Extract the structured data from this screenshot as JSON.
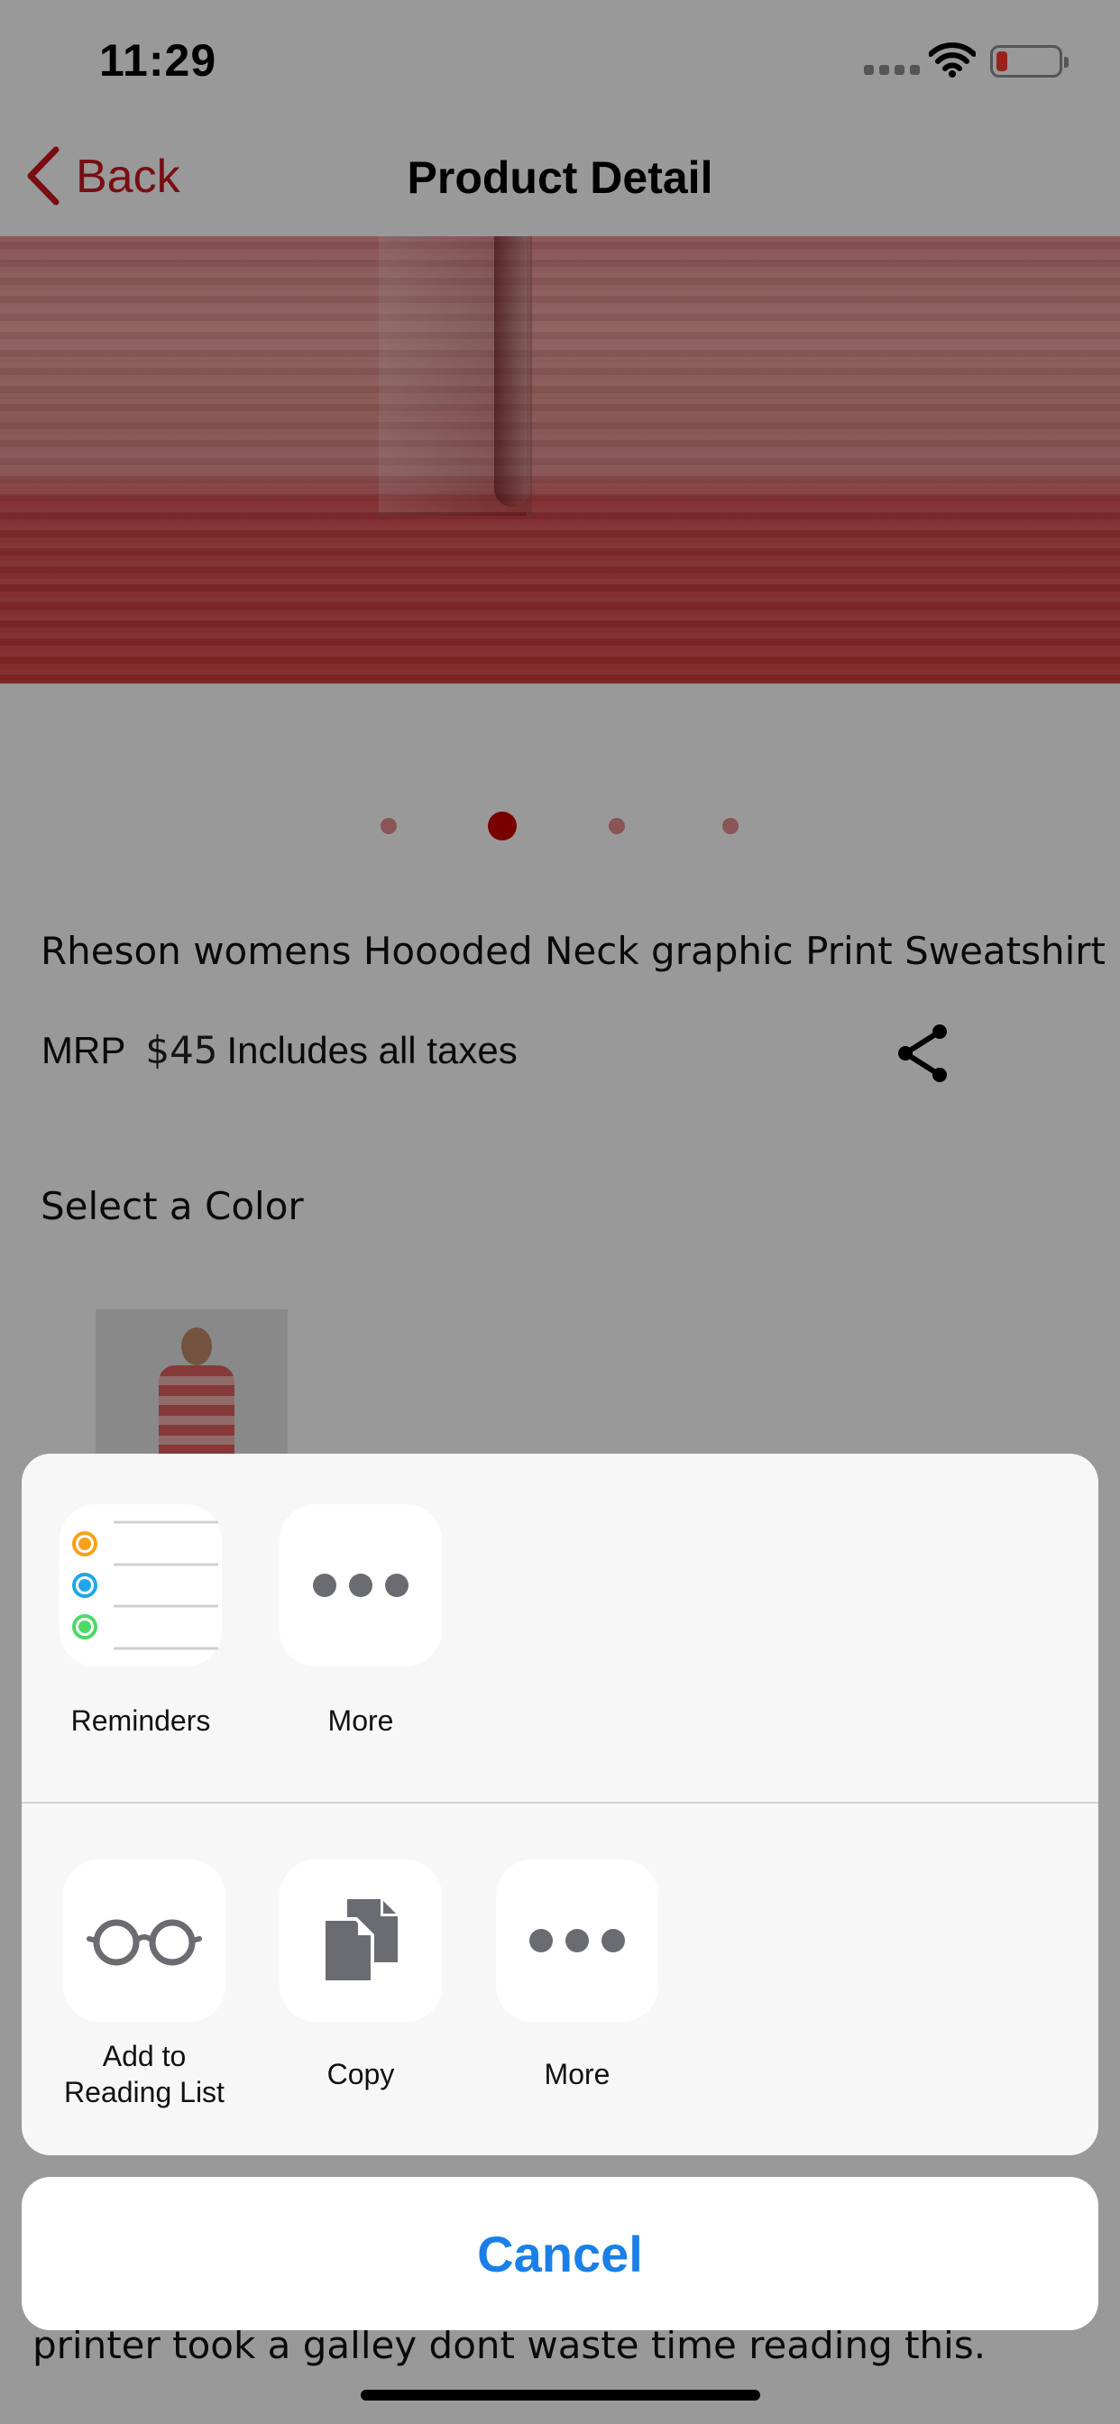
{
  "status_bar": {
    "time": "11:29",
    "battery_level_fraction": 0.15
  },
  "nav_bar": {
    "back_label": "Back",
    "title": "Product Detail"
  },
  "carousel": {
    "page_count": 4,
    "active_index": 1
  },
  "product": {
    "name": "Rheson womens Hoooded Neck graphic Print Sweatshirt",
    "mrp_label": "MRP",
    "price": "$45",
    "tax_note": "Includes all taxes",
    "select_color_label": "Select a Color"
  },
  "description_visible_line": "printer took a galley dont waste time reading this.",
  "share_sheet": {
    "apps_row": [
      {
        "label": "Reminders",
        "icon": "reminders-icon"
      },
      {
        "label": "More",
        "icon": "more-dots-icon"
      }
    ],
    "actions_row": [
      {
        "label_line1": "Add to",
        "label_line2": "Reading List",
        "icon": "glasses-icon"
      },
      {
        "label_line1": "Copy",
        "label_line2": "",
        "icon": "copy-icon"
      },
      {
        "label_line1": "More",
        "label_line2": "",
        "icon": "more-dots-icon"
      }
    ],
    "cancel_label": "Cancel"
  },
  "colors": {
    "accent_red": "#c8171e",
    "ios_blue": "#1a7fe8",
    "reminder_orange": "#f7a11a",
    "reminder_blue": "#1fa7e8",
    "reminder_green": "#4cd964"
  }
}
